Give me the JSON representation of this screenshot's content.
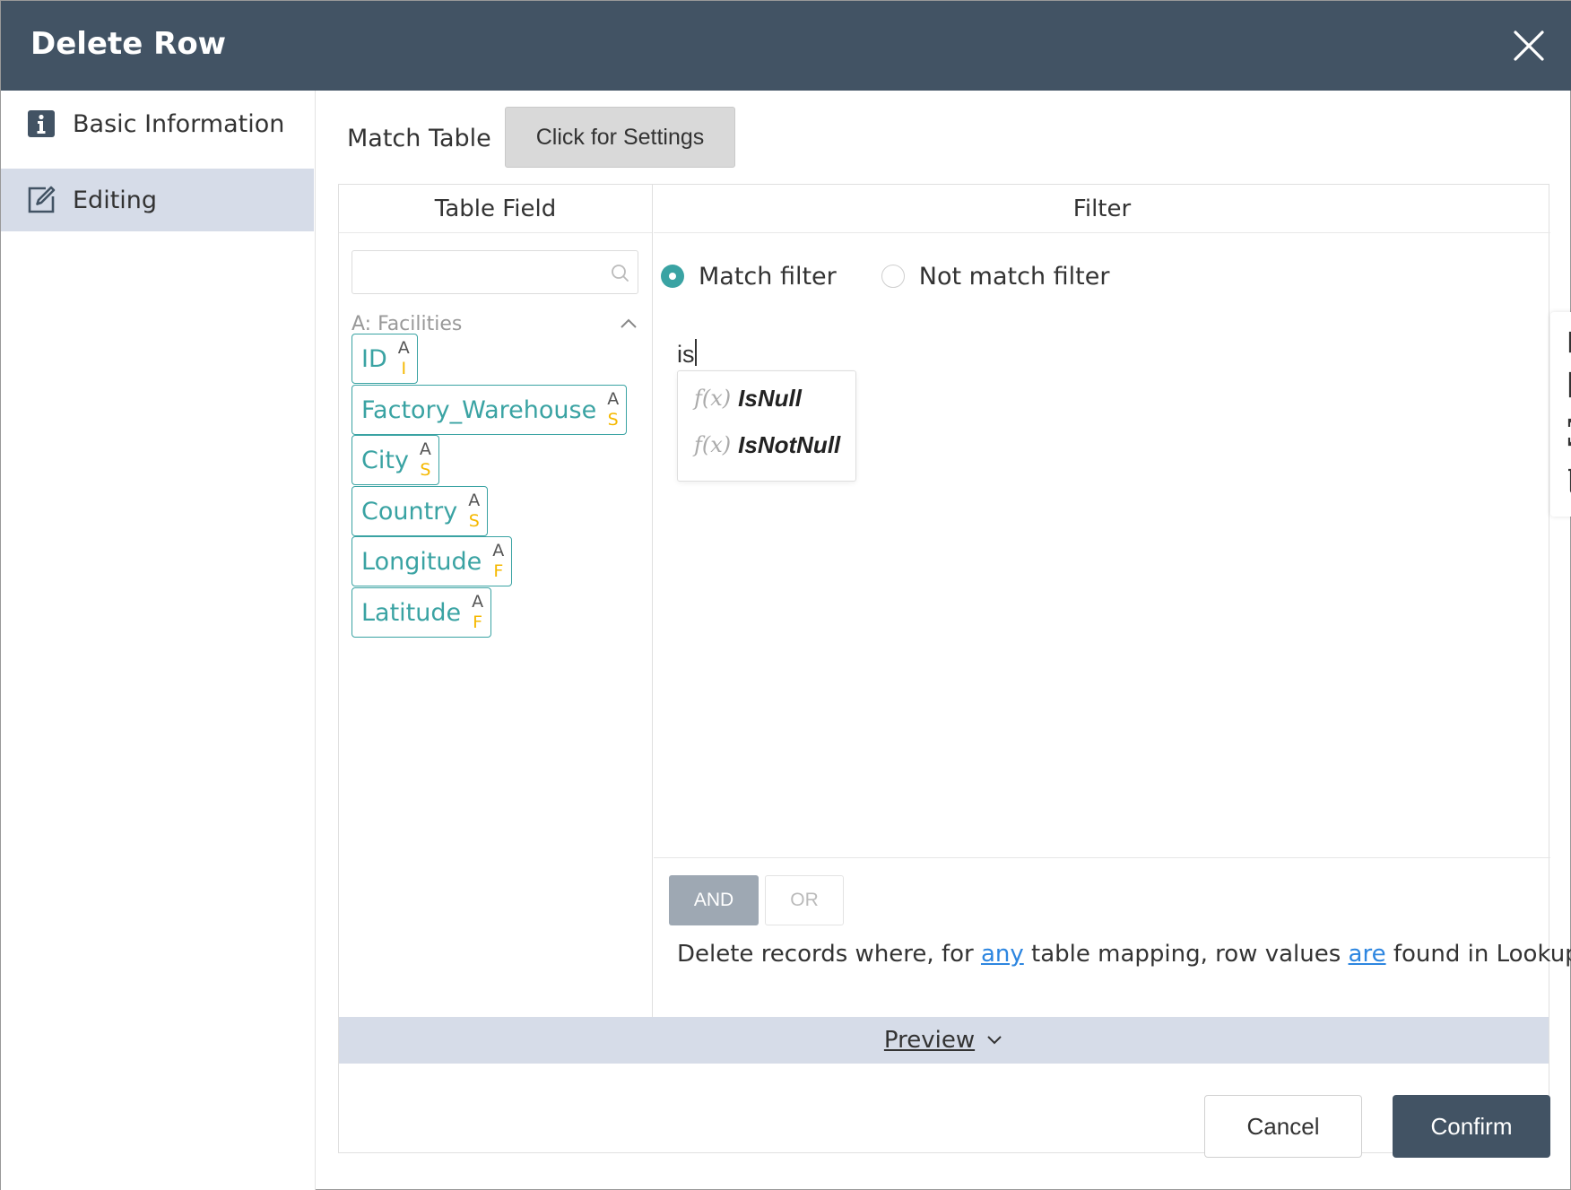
{
  "dialog": {
    "title": "Delete Row"
  },
  "sidebar": {
    "items": [
      {
        "label": "Basic Information",
        "icon": "info-icon"
      },
      {
        "label": "Editing",
        "icon": "edit-icon"
      }
    ]
  },
  "main": {
    "match_table_label": "Match Table",
    "settings_button": "Click for Settings"
  },
  "fields": {
    "header": "Table Field",
    "search_placeholder": "",
    "group": "A: Facilities",
    "items": [
      {
        "name": "ID",
        "tag_top": "A",
        "tag_bottom": "I"
      },
      {
        "name": "Factory_Warehouse",
        "tag_top": "A",
        "tag_bottom": "S"
      },
      {
        "name": "City",
        "tag_top": "A",
        "tag_bottom": "S"
      },
      {
        "name": "Country",
        "tag_top": "A",
        "tag_bottom": "S"
      },
      {
        "name": "Longitude",
        "tag_top": "A",
        "tag_bottom": "F"
      },
      {
        "name": "Latitude",
        "tag_top": "A",
        "tag_bottom": "F"
      }
    ]
  },
  "filter": {
    "header": "Filter",
    "radio_match": "Match filter",
    "radio_not_match": "Not match filter",
    "selected": "Match filter",
    "expression": "is",
    "suggestions": [
      {
        "prefix": "f(x)",
        "name": "IsNull"
      },
      {
        "prefix": "f(x)",
        "name": "IsNotNull"
      }
    ],
    "tools": [
      "copy-icon",
      "paste-icon",
      "expand-icon",
      "trash-icon"
    ],
    "and_label": "AND",
    "or_label": "OR",
    "desc_1": "Delete records where, for ",
    "desc_link_1": "any",
    "desc_2": " table mapping, row values ",
    "desc_link_2": "are",
    "desc_3": " found in Lookup."
  },
  "preview": {
    "label": "Preview"
  },
  "footer": {
    "cancel": "Cancel",
    "confirm": "Confirm"
  },
  "colors": {
    "header_bg": "#425364",
    "accent": "#3aa3a3",
    "tag_yellow": "#f5b800",
    "active_bg": "#d6dce8",
    "link": "#2d86e0"
  }
}
